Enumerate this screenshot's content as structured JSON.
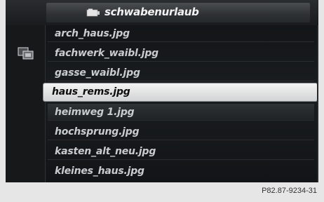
{
  "header": {
    "folder_name": "schwabenurlaub",
    "icon": "folder-icon"
  },
  "sidebar": {
    "icon": "media-browse-icon"
  },
  "files": [
    {
      "name": "arch_haus.jpg",
      "state": "normal"
    },
    {
      "name": "fachwerk_waibl.jpg",
      "state": "normal"
    },
    {
      "name": "gasse_waibl.jpg",
      "state": "normal"
    },
    {
      "name": "haus_rems.jpg",
      "state": "selected"
    },
    {
      "name": "heimweg 1.jpg",
      "state": "normal"
    },
    {
      "name": "hochsprung.jpg",
      "state": "normal"
    },
    {
      "name": "kasten_alt_neu.jpg",
      "state": "normal"
    },
    {
      "name": "kleines_haus.jpg",
      "state": "normal"
    }
  ],
  "colors": {
    "selection": "#e8e8e8",
    "background": "#15181a",
    "text": "#c9ccce"
  },
  "footer": {
    "reference": "P82.87-9234-31"
  }
}
